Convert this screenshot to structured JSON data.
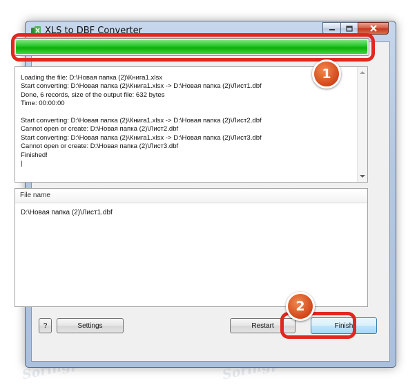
{
  "window": {
    "title": "XLS to DBF Converter",
    "buttons": {
      "minimize": "minimize",
      "maximize": "maximize",
      "close": "close"
    }
  },
  "progress": {
    "fraction": 1.0,
    "color": "#1dbf1d"
  },
  "callouts": {
    "first": "1",
    "second": "2",
    "ring_color": "#e2271f"
  },
  "log": {
    "lines": [
      "Loading the file: D:\\Новая папка (2)\\Книга1.xlsx",
      "Start converting: D:\\Новая папка (2)\\Книга1.xlsx -> D:\\Новая папка (2)\\Лист1.dbf",
      "Done, 6 records, size of the output file: 632 bytes",
      "Time: 00:00:00",
      "",
      "Start converting: D:\\Новая папка (2)\\Книга1.xlsx -> D:\\Новая папка (2)\\Лист2.dbf",
      "Cannot open or create: D:\\Новая папка (2)\\Лист2.dbf",
      "Start converting: D:\\Новая папка (2)\\Книга1.xlsx -> D:\\Новая папка (2)\\Лист3.dbf",
      "Cannot open or create: D:\\Новая папка (2)\\Лист3.dbf",
      "Finished!",
      "|"
    ]
  },
  "file_list": {
    "column_header": "File name",
    "rows": [
      "D:\\Новая папка (2)\\Лист1.dbf"
    ]
  },
  "footer": {
    "help_label": "?",
    "settings_label": "Settings",
    "restart_label": "Restart",
    "finish_label": "Finish"
  },
  "watermark": "Soringpcrepair.com"
}
